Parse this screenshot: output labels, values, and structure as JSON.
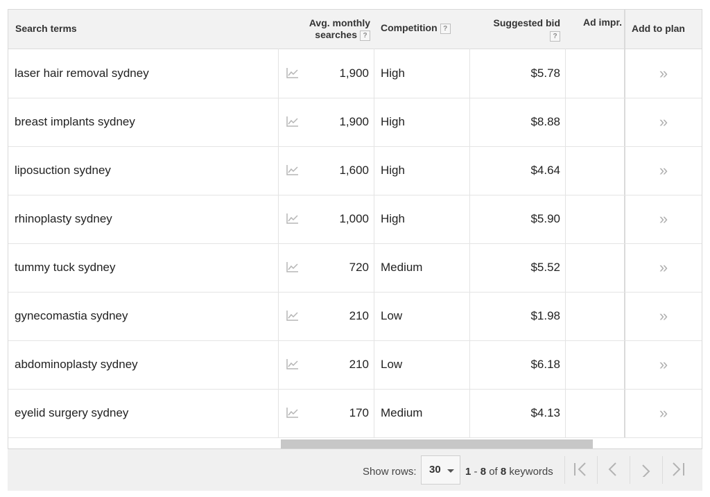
{
  "headers": {
    "search_terms": "Search terms",
    "avg_line1": "Avg. monthly",
    "avg_line2": "searches",
    "competition": "Competition",
    "suggested_bid": "Suggested bid",
    "ad_impr": "Ad impr.",
    "add_to_plan": "Add to plan",
    "help_glyph": "?"
  },
  "rows": [
    {
      "term": "laser hair removal sydney",
      "searches": "1,900",
      "competition": "High",
      "bid": "$5.78"
    },
    {
      "term": "breast implants sydney",
      "searches": "1,900",
      "competition": "High",
      "bid": "$8.88"
    },
    {
      "term": "liposuction sydney",
      "searches": "1,600",
      "competition": "High",
      "bid": "$4.64"
    },
    {
      "term": "rhinoplasty sydney",
      "searches": "1,000",
      "competition": "High",
      "bid": "$5.90"
    },
    {
      "term": "tummy tuck sydney",
      "searches": "720",
      "competition": "Medium",
      "bid": "$5.52"
    },
    {
      "term": "gynecomastia sydney",
      "searches": "210",
      "competition": "Low",
      "bid": "$1.98"
    },
    {
      "term": "abdominoplasty sydney",
      "searches": "210",
      "competition": "Low",
      "bid": "$6.18"
    },
    {
      "term": "eyelid surgery sydney",
      "searches": "170",
      "competition": "Medium",
      "bid": "$4.13"
    }
  ],
  "add_glyph": "»",
  "icons": {
    "trend": "trend-chart-icon",
    "add": "add-to-plan-chevron-icon"
  },
  "pagination": {
    "show_rows_label": "Show rows:",
    "rows_value": "30",
    "range_start": "1",
    "range_sep": " - ",
    "range_end": "8",
    "of_word": " of ",
    "total": "8",
    "unit": " keywords"
  },
  "colors": {
    "header_bg": "#f2f2f2",
    "footer_bg": "#f0f0f0",
    "scroll_thumb": "#c7c7c7"
  }
}
